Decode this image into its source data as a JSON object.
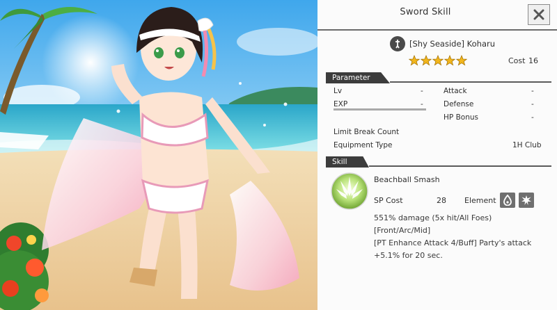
{
  "dialog": {
    "title": "Sword Skill",
    "close_icon": "close-x-icon"
  },
  "character": {
    "class_icon": "sword-class-icon",
    "name": "[Shy Seaside] Koharu",
    "rarity_stars": 5,
    "cost_label": "Cost",
    "cost_value": "16"
  },
  "parameter": {
    "section_label": "Parameter",
    "lv_label": "Lv",
    "lv_value": "-",
    "exp_label": "EXP",
    "exp_value": "-",
    "attack_label": "Attack",
    "attack_value": "-",
    "defense_label": "Defense",
    "defense_value": "-",
    "hp_bonus_label": "HP Bonus",
    "hp_bonus_value": "-",
    "limit_break_label": "Limit Break Count",
    "equipment_type_label": "Equipment Type",
    "equipment_type_value": "1H Club"
  },
  "skill": {
    "section_label": "Skill",
    "name": "Beachball Smash",
    "sp_cost_label": "SP Cost",
    "sp_cost_value": "28",
    "element_label": "Element",
    "element_icons": [
      "water-drop-icon",
      "burst-icon"
    ],
    "description_line1": "551% damage (5x hit/All Foes)[Front/Arc/Mid]",
    "description_line2": "[PT Enhance Attack 4/Buff] Party's attack +5.1% for 20 sec."
  },
  "colors": {
    "star_fill": "#f2b61c",
    "section_tab": "#3c3c3c",
    "badge_grey": "#6f6f6f",
    "skill_icon_green": "#9fd35a"
  }
}
